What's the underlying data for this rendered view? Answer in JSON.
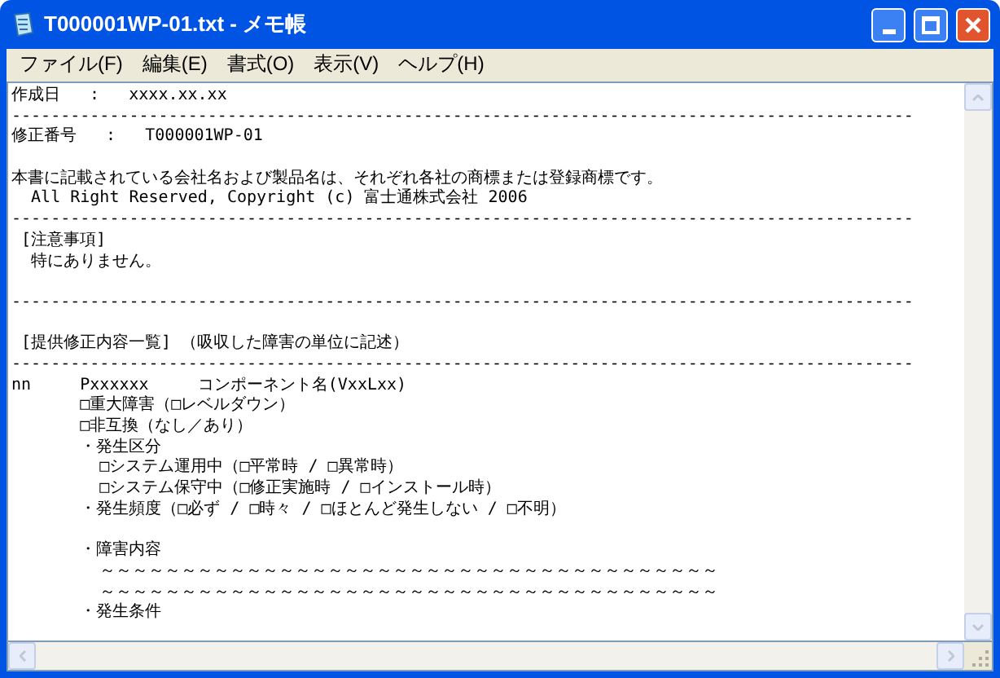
{
  "window": {
    "title": "T000001WP-01.txt - メモ帳"
  },
  "menu": [
    "ファイル(F)",
    "編集(E)",
    "書式(O)",
    "表示(V)",
    "ヘルプ(H)"
  ],
  "lines": [
    {
      "kind": "text",
      "text": "作成日   :   xxxx.xx.xx"
    },
    {
      "kind": "text",
      "text": "--------------------------------------------------------------------------------------------"
    },
    {
      "kind": "text",
      "text": "修正番号   :   T000001WP-01"
    },
    {
      "kind": "blank"
    },
    {
      "kind": "text",
      "text": "本書に記載されている会社名および製品名は、それぞれ各社の商標または登録商標です。"
    },
    {
      "kind": "text",
      "text": "  All Right Reserved, Copyright (c) 富士通株式会社 2006"
    },
    {
      "kind": "text",
      "text": "--------------------------------------------------------------------------------------------"
    },
    {
      "kind": "text",
      "text": " [注意事項]"
    },
    {
      "kind": "text",
      "text": "  特にありません。"
    },
    {
      "kind": "blank"
    },
    {
      "kind": "text",
      "text": "--------------------------------------------------------------------------------------------"
    },
    {
      "kind": "blank"
    },
    {
      "kind": "text",
      "text": " [提供修正内容一覧] （吸収した障害の単位に記述）"
    },
    {
      "kind": "text",
      "text": "--------------------------------------------------------------------------------------------"
    },
    {
      "kind": "text",
      "text": "nn     Pxxxxxx     コンポーネント名(VxxLxx)"
    },
    {
      "kind": "text",
      "text": "       □重大障害（□レベルダウン）"
    },
    {
      "kind": "text",
      "text": "       □非互換（なし／あり）"
    },
    {
      "kind": "text",
      "text": "       ・発生区分"
    },
    {
      "kind": "text",
      "text": "         □システム運用中（□平常時 / □異常時）"
    },
    {
      "kind": "text",
      "text": "         □システム保守中（□修正実施時 / □インストール時）"
    },
    {
      "kind": "text",
      "text": "       ・発生頻度（□必ず / □時々 / □ほとんど発生しない / □不明）"
    },
    {
      "kind": "blank"
    },
    {
      "kind": "text",
      "text": "       ・障害内容"
    },
    {
      "kind": "text",
      "text": "         ～～～～～～～～～～～～～～～～～～～～～～～～～～～～～～～～～～～～～～"
    },
    {
      "kind": "text",
      "text": "         ～～～～～～～～～～～～～～～～～～～～～～～～～～～～～～～～～～～～～～"
    },
    {
      "kind": "text",
      "text": "       ・発生条件"
    }
  ]
}
